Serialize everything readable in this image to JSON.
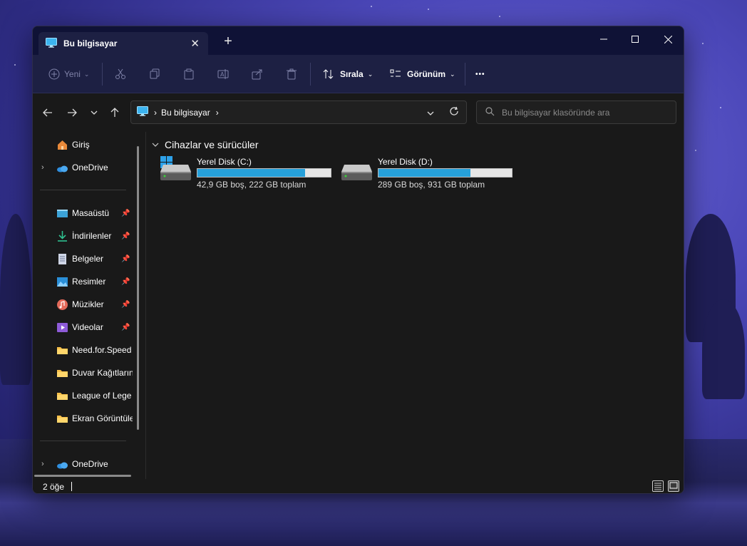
{
  "window": {
    "tab_title": "Bu bilgisayar",
    "new_tab": "+"
  },
  "toolbar": {
    "new_label": "Yeni",
    "sort_label": "Sırala",
    "view_label": "Görünüm",
    "more_label": "•••"
  },
  "navigation": {
    "breadcrumb": [
      "Bu bilgisayar"
    ],
    "search_placeholder": "Bu bilgisayar klasöründe ara"
  },
  "sidebar": {
    "top_items": [
      {
        "label": "Giriş",
        "icon": "home-icon"
      },
      {
        "label": "OneDrive",
        "icon": "cloud-icon",
        "expandable": true
      }
    ],
    "quick_access": [
      {
        "label": "Masaüstü",
        "icon": "desktop-icon",
        "pinned": true
      },
      {
        "label": "İndirilenler",
        "icon": "download-icon",
        "pinned": true
      },
      {
        "label": "Belgeler",
        "icon": "document-icon",
        "pinned": true
      },
      {
        "label": "Resimler",
        "icon": "pictures-icon",
        "pinned": true
      },
      {
        "label": "Müzikler",
        "icon": "music-icon",
        "pinned": true
      },
      {
        "label": "Videolar",
        "icon": "video-icon",
        "pinned": true
      },
      {
        "label": "Need.for.Speed",
        "icon": "folder-icon",
        "pinned": false
      },
      {
        "label": "Duvar Kağıtların",
        "icon": "folder-icon",
        "pinned": false
      },
      {
        "label": "League of Lege",
        "icon": "folder-icon",
        "pinned": false
      },
      {
        "label": "Ekran Görüntüle",
        "icon": "folder-icon",
        "pinned": false
      }
    ],
    "bottom_items": [
      {
        "label": "OneDrive",
        "icon": "cloud-icon",
        "expandable": true
      }
    ]
  },
  "content": {
    "group_title": "Cihazlar ve sürücüler",
    "drives": [
      {
        "name": "Yerel Disk (C:)",
        "info": "42,9 GB boş, 222 GB toplam",
        "used_fraction": 0.807,
        "system": true
      },
      {
        "name": "Yerel Disk (D:)",
        "info": "289 GB boş, 931 GB toplam",
        "used_fraction": 0.69,
        "system": false
      }
    ]
  },
  "status": {
    "item_count": "2 öğe"
  },
  "colors": {
    "accent": "#26a0da",
    "titlebar": "#0f1236",
    "toolbar": "#1d2043",
    "body": "#191919"
  }
}
